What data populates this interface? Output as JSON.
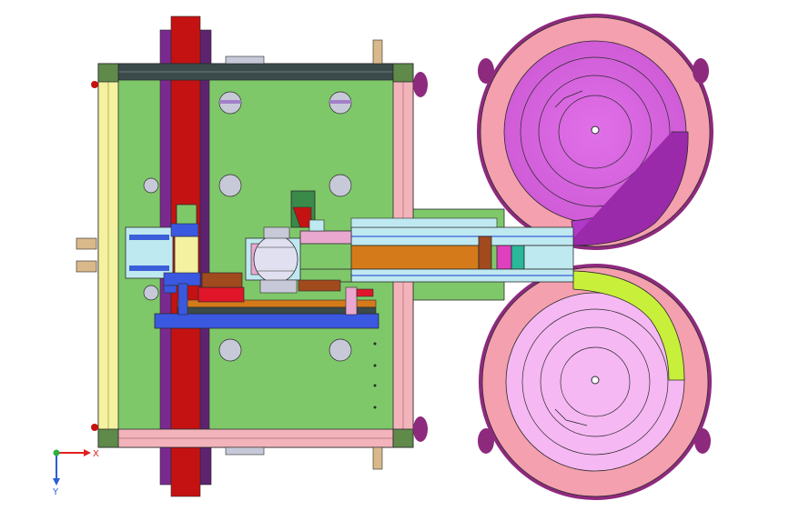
{
  "viewport": {
    "background": "#ffffff"
  },
  "colors": {
    "frame_plate": "#7fc86a",
    "frame_outline": "#2b2b2b",
    "rail_red": "#c41212",
    "rail_purple": "#7a2a8e",
    "beam_dark": "#3b4a4a",
    "beam_pink": "#f3b3bb",
    "profile_yellow": "#f4f1a0",
    "bowl_outer": "#f4a0ae",
    "bowl_rim": "#8e2a7e",
    "bowl_top_inner": "#e070e8",
    "bowl_bottom_inner": "#f5b8f3",
    "track_purple": "#b238c8",
    "track_green": "#c8f03a",
    "hole_fill": "#c7c9d8",
    "hole_purple": "#a37fc9",
    "feeder_orange": "#d47a1a",
    "feeder_light": "#bfe9f0",
    "feeder_blue": "#3a5fd8",
    "feeder_magenta": "#e03fbf",
    "feeder_teal": "#2ab79a",
    "piston_pink": "#e9a8cf",
    "block_red": "#e0152a",
    "block_brown": "#a04a1e",
    "base_blue": "#3a58e0",
    "bracket_tan": "#d9b98a"
  },
  "axis_triad": {
    "x_label": "X",
    "y_label": "Y",
    "x_color": "#e02020",
    "y_color": "#2a5cd8",
    "origin_color": "#2ab040"
  }
}
